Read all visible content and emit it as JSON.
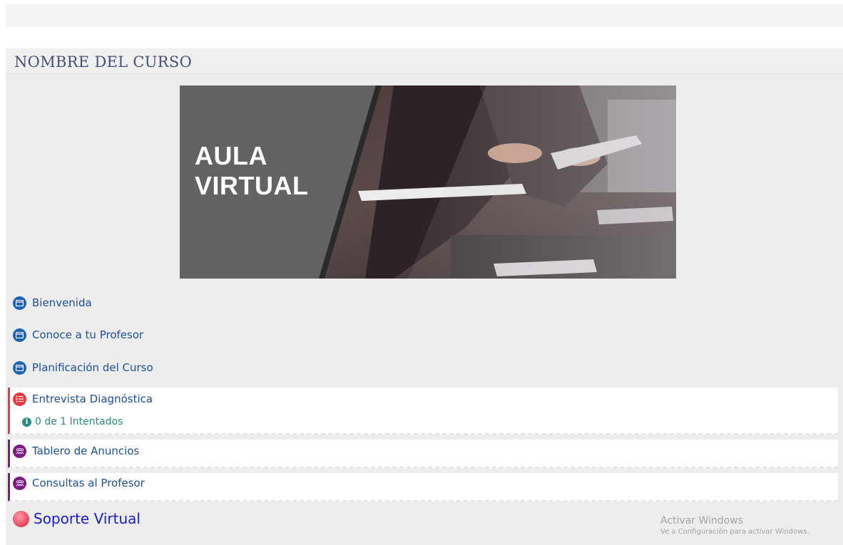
{
  "course": {
    "title": "NOMBRE DEL CURSO"
  },
  "banner": {
    "line1": "AULA",
    "line2": "VIRTUAL"
  },
  "links": [
    {
      "label": "Bienvenida",
      "icon": "window-icon"
    },
    {
      "label": "Conoce a tu Profesor",
      "icon": "window-icon"
    },
    {
      "label": "Planificación del Curso",
      "icon": "window-icon"
    }
  ],
  "quiz": {
    "label": "Entrevista Diagnóstica",
    "icon": "quiz-list-icon",
    "status": "0 de 1 Intentados",
    "status_icon": "info-icon"
  },
  "forums": [
    {
      "label": "Tablero de Anuncios",
      "icon": "forum-people-icon"
    },
    {
      "label": "Consultas al Profesor",
      "icon": "forum-people-icon"
    }
  ],
  "support": {
    "label": "Soporte Virtual"
  },
  "watermark": {
    "title": "Activar Windows",
    "subtitle": "Ve a Configuración para activar Windows."
  },
  "colors": {
    "link": "#1a4f9c",
    "window_icon": "#1c63b7",
    "quiz_accent": "#e8393c",
    "forum_accent": "#7c1b86",
    "status": "#2b8a80",
    "support": "#1a1ad6",
    "title": "#4a4f7a"
  }
}
